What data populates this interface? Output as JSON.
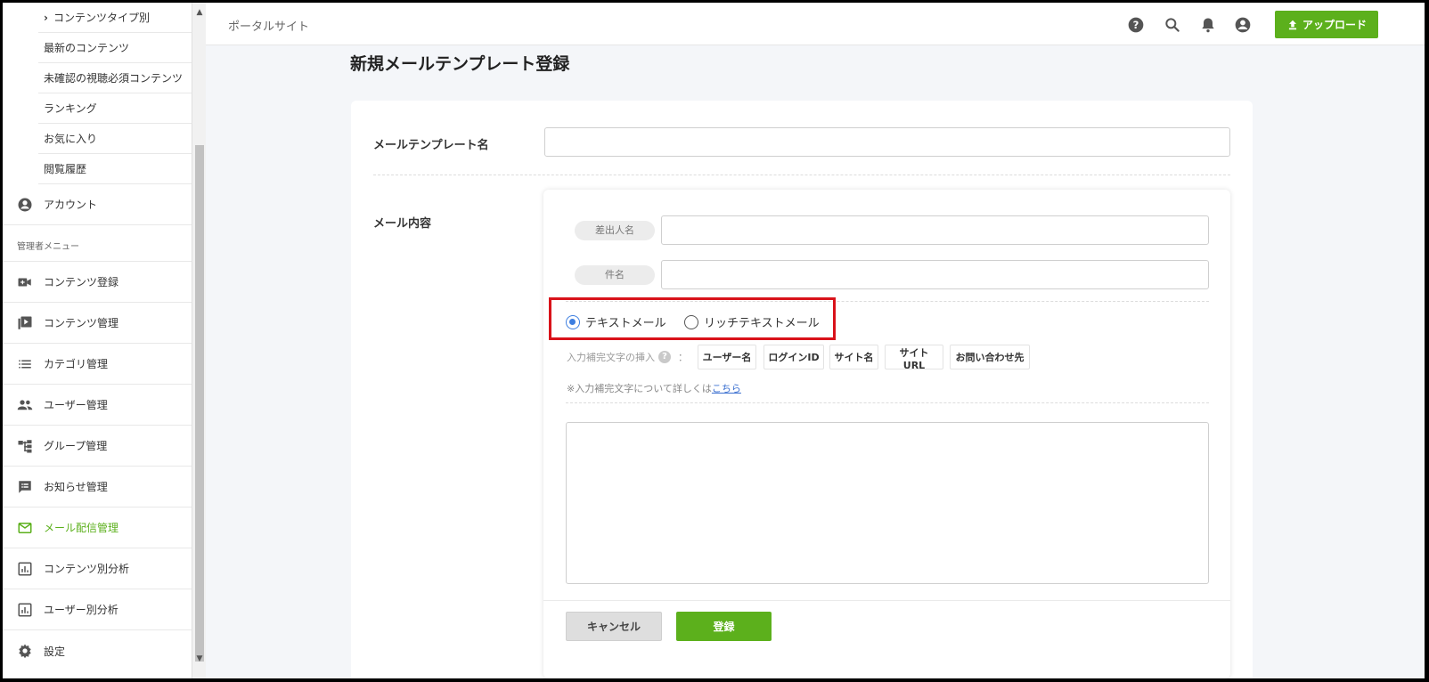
{
  "sidebar": {
    "sub_items": [
      {
        "label": "コンテンツタイプ別",
        "has_chevron": true
      },
      {
        "label": "最新のコンテンツ"
      },
      {
        "label": "未確認の視聴必須コンテンツ"
      },
      {
        "label": "ランキング"
      },
      {
        "label": "お気に入り"
      },
      {
        "label": "閲覧履歴"
      }
    ],
    "account": {
      "label": "アカウント",
      "icon": "account-circle-icon"
    },
    "admin_section_label": "管理者メニュー",
    "admin_items": [
      {
        "label": "コンテンツ登録",
        "icon": "video-camera-icon"
      },
      {
        "label": "コンテンツ管理",
        "icon": "video-library-icon"
      },
      {
        "label": "カテゴリ管理",
        "icon": "list-icon"
      },
      {
        "label": "ユーザー管理",
        "icon": "people-icon"
      },
      {
        "label": "グループ管理",
        "icon": "tree-icon"
      },
      {
        "label": "お知らせ管理",
        "icon": "announcement-icon"
      },
      {
        "label": "メール配信管理",
        "icon": "mail-icon",
        "active": true
      },
      {
        "label": "コンテンツ別分析",
        "icon": "chart-icon"
      },
      {
        "label": "ユーザー別分析",
        "icon": "chart-icon"
      },
      {
        "label": "設定",
        "icon": "gear-icon"
      }
    ]
  },
  "header": {
    "site_name": "ポータルサイト",
    "icons": [
      "help-icon",
      "search-icon",
      "bell-icon",
      "user-icon"
    ],
    "upload_label": "アップロード"
  },
  "page": {
    "title": "新規メールテンプレート登録"
  },
  "form": {
    "template_name_label": "メールテンプレート名",
    "template_name_value": "",
    "content_label": "メール内容",
    "sender_label": "差出人名",
    "sender_value": "",
    "subject_label": "件名",
    "subject_value": "",
    "mail_types": [
      {
        "label": "テキストメール",
        "selected": true
      },
      {
        "label": "リッチテキストメール",
        "selected": false
      }
    ],
    "insert_label": "入力補完文字の挿入",
    "insert_sep": "：",
    "insert_tags": [
      "ユーザー名",
      "ログインID",
      "サイト名",
      "サイトURL",
      "お問い合わせ先"
    ],
    "note_text": "※入力補完文字について詳しくは",
    "note_link": "こちら",
    "body_value": "",
    "cancel_label": "キャンセル",
    "submit_label": "登録"
  },
  "colors": {
    "accent_green": "#5cb01c",
    "highlight_red": "#d9121a",
    "radio_blue": "#3d7ee0"
  }
}
